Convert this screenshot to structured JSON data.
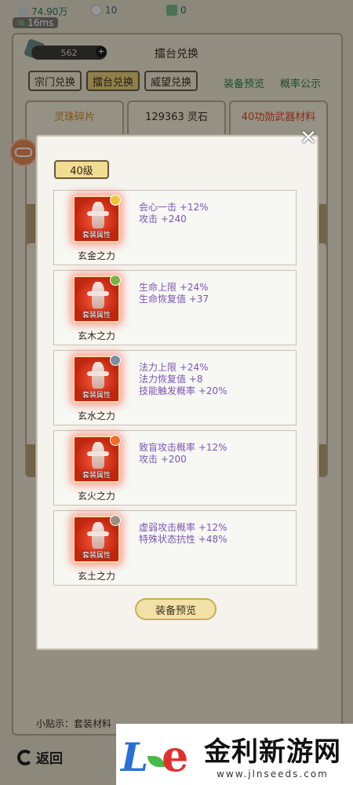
{
  "status": {
    "currency1": "74.90万",
    "currency2": "10",
    "currency3": "0",
    "ping": "16ms"
  },
  "header": {
    "title": "擂台兑换",
    "token_count": "562",
    "token_plus": "+"
  },
  "tabs": [
    {
      "label": "宗门兑换"
    },
    {
      "label": "擂台兑换"
    },
    {
      "label": "威望兑换"
    }
  ],
  "links": {
    "equip_preview": "装备预览",
    "prob_notice": "概率公示"
  },
  "shop": [
    {
      "title": "灵珠碎片"
    },
    {
      "title": "129363 灵石"
    },
    {
      "title": "40功勋武器材料"
    }
  ],
  "tip": "小贴示：套装材料",
  "back_label": "返回",
  "modal": {
    "level": "40级",
    "close_symbol": "✕",
    "tag": "套装属性",
    "sets": [
      {
        "name": "玄金之力",
        "gem_color": "#f0c53a",
        "attrs": [
          "会心一击 +12%",
          "攻击 +240"
        ]
      },
      {
        "name": "玄木之力",
        "gem_color": "#7cb342",
        "attrs": [
          "生命上限 +24%",
          "生命恢复值 +37"
        ]
      },
      {
        "name": "玄水之力",
        "gem_color": "#7c8ea0",
        "attrs": [
          "法力上限 +24%",
          "法力恢复值 +8",
          "技能触发概率 +20%"
        ]
      },
      {
        "name": "玄火之力",
        "gem_color": "#f06d2a",
        "attrs": [
          "致盲攻击概率 +12%",
          "攻击 +200"
        ]
      },
      {
        "name": "玄土之力",
        "gem_color": "#9b8f80",
        "attrs": [
          "虚弱攻击概率 +12%",
          "特殊状态抗性 +48%"
        ]
      }
    ],
    "preview_button": "装备预览"
  },
  "watermark": {
    "title": "金利新游网",
    "url": "www.jlnseeds.com"
  }
}
